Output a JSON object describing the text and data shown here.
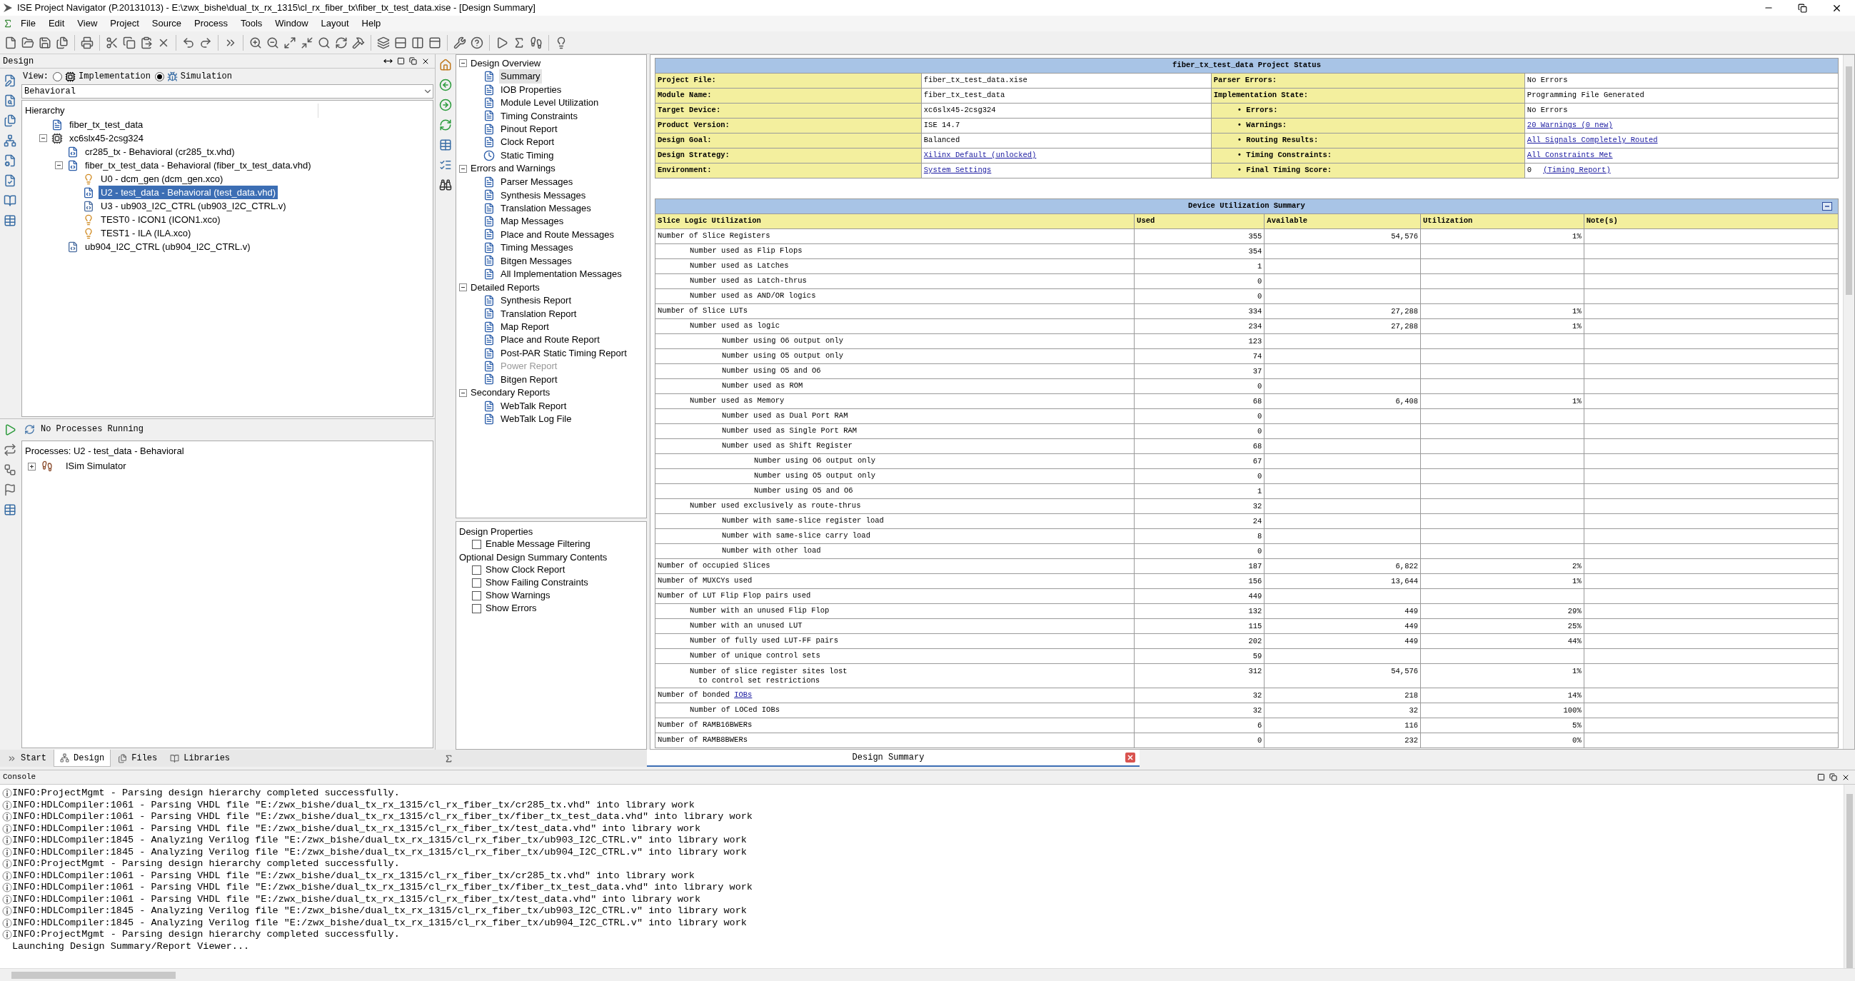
{
  "window": {
    "title": "ISE Project Navigator (P.20131013) - E:\\zwx_bishe\\dual_tx_rx_1315\\cl_rx_fiber_tx\\fiber_tx_test_data.xise - [Design Summary]"
  },
  "menu": [
    "File",
    "Edit",
    "View",
    "Project",
    "Source",
    "Process",
    "Tools",
    "Window",
    "Layout",
    "Help"
  ],
  "design_panel": {
    "title": "Design",
    "view_label": "View:",
    "view_options": [
      {
        "label": "Implementation",
        "selected": false
      },
      {
        "label": "Simulation",
        "selected": true
      }
    ],
    "dropdown": "Behavioral",
    "tree_header": "Hierarchy",
    "tree": [
      {
        "label": "fiber_tx_test_data",
        "kind": "project",
        "selected": false
      },
      {
        "label": "xc6slx45-2csg324",
        "kind": "chip",
        "selected": false,
        "expanded": true,
        "children": [
          {
            "label": "cr285_tx - Behavioral (cr285_tx.vhd)",
            "kind": "vhdl",
            "selected": false
          },
          {
            "label": "fiber_tx_test_data - Behavioral (fiber_tx_test_data.vhd)",
            "kind": "vhdl",
            "selected": false,
            "expanded": true,
            "children": [
              {
                "label": "U0 - dcm_gen (dcm_gen.xco)",
                "kind": "core",
                "selected": false
              },
              {
                "label": "U2 - test_data - Behavioral (test_data.vhd)",
                "kind": "vhdl",
                "selected": true
              },
              {
                "label": "U3 - ub903_I2C_CTRL (ub903_I2C_CTRL.v)",
                "kind": "verilog",
                "selected": false
              },
              {
                "label": "TEST0 - ICON1 (ICON1.xco)",
                "kind": "core",
                "selected": false
              },
              {
                "label": "TEST1 - ILA (ILA.xco)",
                "kind": "core",
                "selected": false
              }
            ]
          },
          {
            "label": "ub904_I2C_CTRL (ub904_I2C_CTRL.v)",
            "kind": "verilog",
            "selected": false
          }
        ]
      }
    ]
  },
  "process_panel": {
    "status": "No Processes Running",
    "title": "Processes: U2 - test_data - Behavioral",
    "items": [
      {
        "label": "ISim Simulator",
        "expanded": false
      }
    ]
  },
  "left_tabs": [
    {
      "label": "Start",
      "selected": false
    },
    {
      "label": "Design",
      "selected": true
    },
    {
      "label": "Files",
      "selected": false
    },
    {
      "label": "Libraries",
      "selected": false
    }
  ],
  "report_nav": {
    "groups": [
      {
        "label": "Design Overview",
        "expanded": true,
        "items": [
          {
            "label": "Summary",
            "kind": "doc",
            "selected": true,
            "disabled": false
          },
          {
            "label": "IOB Properties",
            "kind": "doc",
            "selected": false,
            "disabled": false
          },
          {
            "label": "Module Level Utilization",
            "kind": "doc",
            "selected": false,
            "disabled": false
          },
          {
            "label": "Timing Constraints",
            "kind": "doc",
            "selected": false,
            "disabled": false
          },
          {
            "label": "Pinout Report",
            "kind": "doc",
            "selected": false,
            "disabled": false
          },
          {
            "label": "Clock Report",
            "kind": "doc",
            "selected": false,
            "disabled": false
          },
          {
            "label": "Static Timing",
            "kind": "timing",
            "selected": false,
            "disabled": false
          }
        ]
      },
      {
        "label": "Errors and Warnings",
        "expanded": true,
        "items": [
          {
            "label": "Parser Messages",
            "kind": "doc",
            "selected": false,
            "disabled": false
          },
          {
            "label": "Synthesis Messages",
            "kind": "doc",
            "selected": false,
            "disabled": false
          },
          {
            "label": "Translation Messages",
            "kind": "doc",
            "selected": false,
            "disabled": false
          },
          {
            "label": "Map Messages",
            "kind": "doc",
            "selected": false,
            "disabled": false
          },
          {
            "label": "Place and Route Messages",
            "kind": "doc",
            "selected": false,
            "disabled": false
          },
          {
            "label": "Timing Messages",
            "kind": "doc",
            "selected": false,
            "disabled": false
          },
          {
            "label": "Bitgen Messages",
            "kind": "doc",
            "selected": false,
            "disabled": false
          },
          {
            "label": "All Implementation Messages",
            "kind": "doc",
            "selected": false,
            "disabled": false
          }
        ]
      },
      {
        "label": "Detailed Reports",
        "expanded": true,
        "items": [
          {
            "label": "Synthesis Report",
            "kind": "doc",
            "selected": false,
            "disabled": false
          },
          {
            "label": "Translation Report",
            "kind": "doc",
            "selected": false,
            "disabled": false
          },
          {
            "label": "Map Report",
            "kind": "doc",
            "selected": false,
            "disabled": false
          },
          {
            "label": "Place and Route Report",
            "kind": "doc",
            "selected": false,
            "disabled": false
          },
          {
            "label": "Post-PAR Static Timing Report",
            "kind": "doc",
            "selected": false,
            "disabled": false
          },
          {
            "label": "Power Report",
            "kind": "doc",
            "selected": false,
            "disabled": true
          },
          {
            "label": "Bitgen Report",
            "kind": "doc",
            "selected": false,
            "disabled": false
          }
        ]
      },
      {
        "label": "Secondary Reports",
        "expanded": true,
        "items": [
          {
            "label": "WebTalk Report",
            "kind": "doc",
            "selected": false,
            "disabled": false
          },
          {
            "label": "WebTalk Log File",
            "kind": "doc",
            "selected": false,
            "disabled": false
          }
        ]
      }
    ]
  },
  "properties": {
    "groups": [
      {
        "label": "Design Properties",
        "options": [
          {
            "label": "Enable Message Filtering",
            "checked": false
          }
        ]
      },
      {
        "label": "Optional Design Summary Contents",
        "options": [
          {
            "label": "Show Clock Report",
            "checked": false
          },
          {
            "label": "Show Failing Constraints",
            "checked": false
          },
          {
            "label": "Show Warnings",
            "checked": false
          },
          {
            "label": "Show Errors",
            "checked": false
          }
        ]
      }
    ]
  },
  "project_status": {
    "title": "fiber_tx_test_data Project Status",
    "rows": [
      {
        "label": "Project File:",
        "value": [
          {
            "text": "fiber_tx_test_data.xise",
            "link": false
          }
        ],
        "label2": "Parser Errors:",
        "sub": false,
        "value2": [
          {
            "text": "No Errors",
            "link": false
          }
        ]
      },
      {
        "label": "Module Name:",
        "value": [
          {
            "text": "fiber_tx_test_data",
            "link": false
          }
        ],
        "label2": "Implementation State:",
        "sub": false,
        "value2": [
          {
            "text": "Programming File Generated",
            "link": false
          }
        ]
      },
      {
        "label": "Target Device:",
        "value": [
          {
            "text": "xc6slx45-2csg324",
            "link": false
          }
        ],
        "label2": "• Errors:",
        "sub": true,
        "value2": [
          {
            "text": "No Errors",
            "link": false
          }
        ]
      },
      {
        "label": "Product Version:",
        "value": [
          {
            "text": "ISE 14.7",
            "link": false
          }
        ],
        "label2": "• Warnings:",
        "sub": true,
        "value2": [
          {
            "text": "20 Warnings (0 new)",
            "link": true
          }
        ]
      },
      {
        "label": "Design Goal:",
        "value": [
          {
            "text": "Balanced",
            "link": false
          }
        ],
        "label2": "• Routing Results:",
        "sub": true,
        "value2": [
          {
            "text": "All Signals Completely Routed",
            "link": true
          }
        ]
      },
      {
        "label": "Design Strategy:",
        "value": [
          {
            "text": "Xilinx Default (unlocked)",
            "link": true
          }
        ],
        "label2": "• Timing Constraints:",
        "sub": true,
        "value2": [
          {
            "text": "All Constraints Met",
            "link": true
          }
        ]
      },
      {
        "label": "Environment:",
        "value": [
          {
            "text": "System Settings",
            "link": true
          }
        ],
        "label2": "• Final Timing Score:",
        "sub": true,
        "value2": [
          {
            "text": "0",
            "link": false
          },
          {
            "text": "(Timing Report)",
            "link": true
          }
        ]
      }
    ]
  },
  "utilization": {
    "title": "Device Utilization Summary",
    "columns": [
      "Slice Logic Utilization",
      "Used",
      "Available",
      "Utilization",
      "Note(s)"
    ],
    "rows": [
      {
        "label": "Number of Slice Registers",
        "used": "355",
        "available": "54,576",
        "utilization": "1%",
        "children": [
          {
            "label": "Number used as Flip Flops",
            "used": "354"
          },
          {
            "label": "Number used as Latches",
            "used": "1"
          },
          {
            "label": "Number used as Latch-thrus",
            "used": "0"
          },
          {
            "label": "Number used as AND/OR logics",
            "used": "0"
          }
        ]
      },
      {
        "label": "Number of Slice LUTs",
        "used": "334",
        "available": "27,288",
        "utilization": "1%",
        "children": [
          {
            "label": "Number used as logic",
            "used": "234",
            "available": "27,288",
            "utilization": "1%",
            "children": [
              {
                "label": "Number using O6 output only",
                "used": "123"
              },
              {
                "label": "Number using O5 output only",
                "used": "74"
              },
              {
                "label": "Number using O5 and O6",
                "used": "37"
              },
              {
                "label": "Number used as ROM",
                "used": "0"
              }
            ]
          },
          {
            "label": "Number used as Memory",
            "used": "68",
            "available": "6,408",
            "utilization": "1%",
            "children": [
              {
                "label": "Number used as Dual Port RAM",
                "used": "0"
              },
              {
                "label": "Number used as Single Port RAM",
                "used": "0"
              },
              {
                "label": "Number used as Shift Register",
                "used": "68",
                "children": [
                  {
                    "label": "Number using O6 output only",
                    "used": "67"
                  },
                  {
                    "label": "Number using O5 output only",
                    "used": "0"
                  },
                  {
                    "label": "Number using O5 and O6",
                    "used": "1"
                  }
                ]
              }
            ]
          },
          {
            "label": "Number used exclusively as route-thrus",
            "used": "32",
            "children": [
              {
                "label": "Number with same-slice register load",
                "used": "24"
              },
              {
                "label": "Number with same-slice carry load",
                "used": "8"
              },
              {
                "label": "Number with other load",
                "used": "0"
              }
            ]
          }
        ]
      },
      {
        "label": "Number of occupied Slices",
        "used": "187",
        "available": "6,822",
        "utilization": "2%"
      },
      {
        "label": "Number of MUXCYs used",
        "used": "156",
        "available": "13,644",
        "utilization": "1%"
      },
      {
        "label": "Number of LUT Flip Flop pairs used",
        "used": "449",
        "children": [
          {
            "label": "Number with an unused Flip Flop",
            "used": "132",
            "available": "449",
            "utilization": "29%"
          },
          {
            "label": "Number with an unused LUT",
            "used": "115",
            "available": "449",
            "utilization": "25%"
          },
          {
            "label": "Number of fully used LUT-FF pairs",
            "used": "202",
            "available": "449",
            "utilization": "44%"
          },
          {
            "label": "Number of unique control sets",
            "used": "59"
          },
          {
            "label_lines": [
              "Number of slice register sites lost",
              "to control set restrictions"
            ],
            "used": "312",
            "available": "54,576",
            "utilization": "1%"
          }
        ]
      },
      {
        "label": "Number of bonded",
        "link": "IOBs",
        "used": "32",
        "available": "218",
        "utilization": "14%",
        "children": [
          {
            "label": "Number of LOCed IOBs",
            "used": "32",
            "available": "32",
            "utilization": "100%"
          }
        ]
      },
      {
        "label": "Number of RAMB16BWERs",
        "used": "6",
        "available": "116",
        "utilization": "5%"
      },
      {
        "label": "Number of RAMB8BWERs",
        "used": "0",
        "available": "232",
        "utilization": "0%"
      }
    ]
  },
  "document_tab": {
    "label": "Design Summary"
  },
  "console": {
    "title": "Console",
    "lines": [
      {
        "kind": "info",
        "text": "INFO:ProjectMgmt - Parsing design hierarchy completed successfully."
      },
      {
        "kind": "info",
        "text": "INFO:HDLCompiler:1061 - Parsing VHDL file \"E:/zwx_bishe/dual_tx_rx_1315/cl_rx_fiber_tx/cr285_tx.vhd\" into library work"
      },
      {
        "kind": "info",
        "text": "INFO:HDLCompiler:1061 - Parsing VHDL file \"E:/zwx_bishe/dual_tx_rx_1315/cl_rx_fiber_tx/fiber_tx_test_data.vhd\" into library work"
      },
      {
        "kind": "info",
        "text": "INFO:HDLCompiler:1061 - Parsing VHDL file \"E:/zwx_bishe/dual_tx_rx_1315/cl_rx_fiber_tx/test_data.vhd\" into library work"
      },
      {
        "kind": "info",
        "text": "INFO:HDLCompiler:1845 - Analyzing Verilog file \"E:/zwx_bishe/dual_tx_rx_1315/cl_rx_fiber_tx/ub903_I2C_CTRL.v\" into library work"
      },
      {
        "kind": "info",
        "text": "INFO:HDLCompiler:1845 - Analyzing Verilog file \"E:/zwx_bishe/dual_tx_rx_1315/cl_rx_fiber_tx/ub904_I2C_CTRL.v\" into library work"
      },
      {
        "kind": "info",
        "text": "INFO:ProjectMgmt - Parsing design hierarchy completed successfully."
      },
      {
        "kind": "info",
        "text": "INFO:HDLCompiler:1061 - Parsing VHDL file \"E:/zwx_bishe/dual_tx_rx_1315/cl_rx_fiber_tx/cr285_tx.vhd\" into library work"
      },
      {
        "kind": "info",
        "text": "INFO:HDLCompiler:1061 - Parsing VHDL file \"E:/zwx_bishe/dual_tx_rx_1315/cl_rx_fiber_tx/fiber_tx_test_data.vhd\" into library work"
      },
      {
        "kind": "info",
        "text": "INFO:HDLCompiler:1061 - Parsing VHDL file \"E:/zwx_bishe/dual_tx_rx_1315/cl_rx_fiber_tx/test_data.vhd\" into library work"
      },
      {
        "kind": "info",
        "text": "INFO:HDLCompiler:1845 - Analyzing Verilog file \"E:/zwx_bishe/dual_tx_rx_1315/cl_rx_fiber_tx/ub903_I2C_CTRL.v\" into library work"
      },
      {
        "kind": "info",
        "text": "INFO:HDLCompiler:1845 - Analyzing Verilog file \"E:/zwx_bishe/dual_tx_rx_1315/cl_rx_fiber_tx/ub904_I2C_CTRL.v\" into library work"
      },
      {
        "kind": "info",
        "text": "INFO:ProjectMgmt - Parsing design hierarchy completed successfully."
      },
      {
        "kind": "plain",
        "text": "Launching Design Summary/Report Viewer..."
      }
    ]
  }
}
